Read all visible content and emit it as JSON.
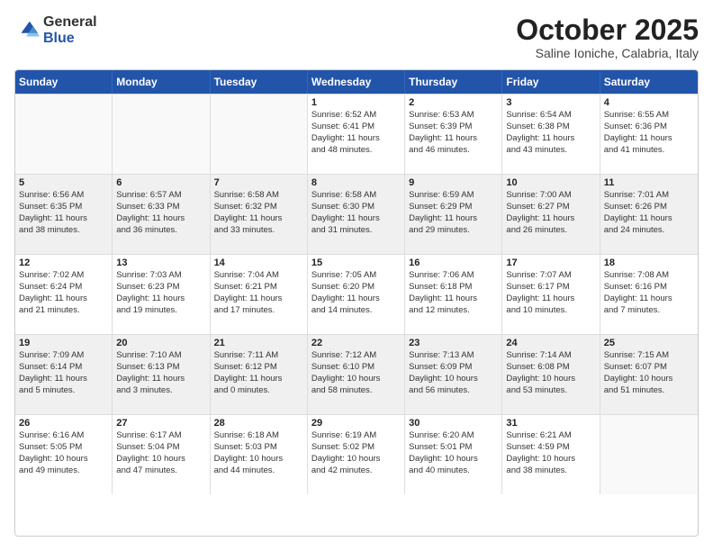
{
  "header": {
    "logo_general": "General",
    "logo_blue": "Blue",
    "month": "October 2025",
    "location": "Saline Ioniche, Calabria, Italy"
  },
  "days_of_week": [
    "Sunday",
    "Monday",
    "Tuesday",
    "Wednesday",
    "Thursday",
    "Friday",
    "Saturday"
  ],
  "rows": [
    [
      {
        "day": "",
        "info": ""
      },
      {
        "day": "",
        "info": ""
      },
      {
        "day": "",
        "info": ""
      },
      {
        "day": "1",
        "info": "Sunrise: 6:52 AM\nSunset: 6:41 PM\nDaylight: 11 hours\nand 48 minutes."
      },
      {
        "day": "2",
        "info": "Sunrise: 6:53 AM\nSunset: 6:39 PM\nDaylight: 11 hours\nand 46 minutes."
      },
      {
        "day": "3",
        "info": "Sunrise: 6:54 AM\nSunset: 6:38 PM\nDaylight: 11 hours\nand 43 minutes."
      },
      {
        "day": "4",
        "info": "Sunrise: 6:55 AM\nSunset: 6:36 PM\nDaylight: 11 hours\nand 41 minutes."
      }
    ],
    [
      {
        "day": "5",
        "info": "Sunrise: 6:56 AM\nSunset: 6:35 PM\nDaylight: 11 hours\nand 38 minutes."
      },
      {
        "day": "6",
        "info": "Sunrise: 6:57 AM\nSunset: 6:33 PM\nDaylight: 11 hours\nand 36 minutes."
      },
      {
        "day": "7",
        "info": "Sunrise: 6:58 AM\nSunset: 6:32 PM\nDaylight: 11 hours\nand 33 minutes."
      },
      {
        "day": "8",
        "info": "Sunrise: 6:58 AM\nSunset: 6:30 PM\nDaylight: 11 hours\nand 31 minutes."
      },
      {
        "day": "9",
        "info": "Sunrise: 6:59 AM\nSunset: 6:29 PM\nDaylight: 11 hours\nand 29 minutes."
      },
      {
        "day": "10",
        "info": "Sunrise: 7:00 AM\nSunset: 6:27 PM\nDaylight: 11 hours\nand 26 minutes."
      },
      {
        "day": "11",
        "info": "Sunrise: 7:01 AM\nSunset: 6:26 PM\nDaylight: 11 hours\nand 24 minutes."
      }
    ],
    [
      {
        "day": "12",
        "info": "Sunrise: 7:02 AM\nSunset: 6:24 PM\nDaylight: 11 hours\nand 21 minutes."
      },
      {
        "day": "13",
        "info": "Sunrise: 7:03 AM\nSunset: 6:23 PM\nDaylight: 11 hours\nand 19 minutes."
      },
      {
        "day": "14",
        "info": "Sunrise: 7:04 AM\nSunset: 6:21 PM\nDaylight: 11 hours\nand 17 minutes."
      },
      {
        "day": "15",
        "info": "Sunrise: 7:05 AM\nSunset: 6:20 PM\nDaylight: 11 hours\nand 14 minutes."
      },
      {
        "day": "16",
        "info": "Sunrise: 7:06 AM\nSunset: 6:18 PM\nDaylight: 11 hours\nand 12 minutes."
      },
      {
        "day": "17",
        "info": "Sunrise: 7:07 AM\nSunset: 6:17 PM\nDaylight: 11 hours\nand 10 minutes."
      },
      {
        "day": "18",
        "info": "Sunrise: 7:08 AM\nSunset: 6:16 PM\nDaylight: 11 hours\nand 7 minutes."
      }
    ],
    [
      {
        "day": "19",
        "info": "Sunrise: 7:09 AM\nSunset: 6:14 PM\nDaylight: 11 hours\nand 5 minutes."
      },
      {
        "day": "20",
        "info": "Sunrise: 7:10 AM\nSunset: 6:13 PM\nDaylight: 11 hours\nand 3 minutes."
      },
      {
        "day": "21",
        "info": "Sunrise: 7:11 AM\nSunset: 6:12 PM\nDaylight: 11 hours\nand 0 minutes."
      },
      {
        "day": "22",
        "info": "Sunrise: 7:12 AM\nSunset: 6:10 PM\nDaylight: 10 hours\nand 58 minutes."
      },
      {
        "day": "23",
        "info": "Sunrise: 7:13 AM\nSunset: 6:09 PM\nDaylight: 10 hours\nand 56 minutes."
      },
      {
        "day": "24",
        "info": "Sunrise: 7:14 AM\nSunset: 6:08 PM\nDaylight: 10 hours\nand 53 minutes."
      },
      {
        "day": "25",
        "info": "Sunrise: 7:15 AM\nSunset: 6:07 PM\nDaylight: 10 hours\nand 51 minutes."
      }
    ],
    [
      {
        "day": "26",
        "info": "Sunrise: 6:16 AM\nSunset: 5:05 PM\nDaylight: 10 hours\nand 49 minutes."
      },
      {
        "day": "27",
        "info": "Sunrise: 6:17 AM\nSunset: 5:04 PM\nDaylight: 10 hours\nand 47 minutes."
      },
      {
        "day": "28",
        "info": "Sunrise: 6:18 AM\nSunset: 5:03 PM\nDaylight: 10 hours\nand 44 minutes."
      },
      {
        "day": "29",
        "info": "Sunrise: 6:19 AM\nSunset: 5:02 PM\nDaylight: 10 hours\nand 42 minutes."
      },
      {
        "day": "30",
        "info": "Sunrise: 6:20 AM\nSunset: 5:01 PM\nDaylight: 10 hours\nand 40 minutes."
      },
      {
        "day": "31",
        "info": "Sunrise: 6:21 AM\nSunset: 4:59 PM\nDaylight: 10 hours\nand 38 minutes."
      },
      {
        "day": "",
        "info": ""
      }
    ]
  ]
}
